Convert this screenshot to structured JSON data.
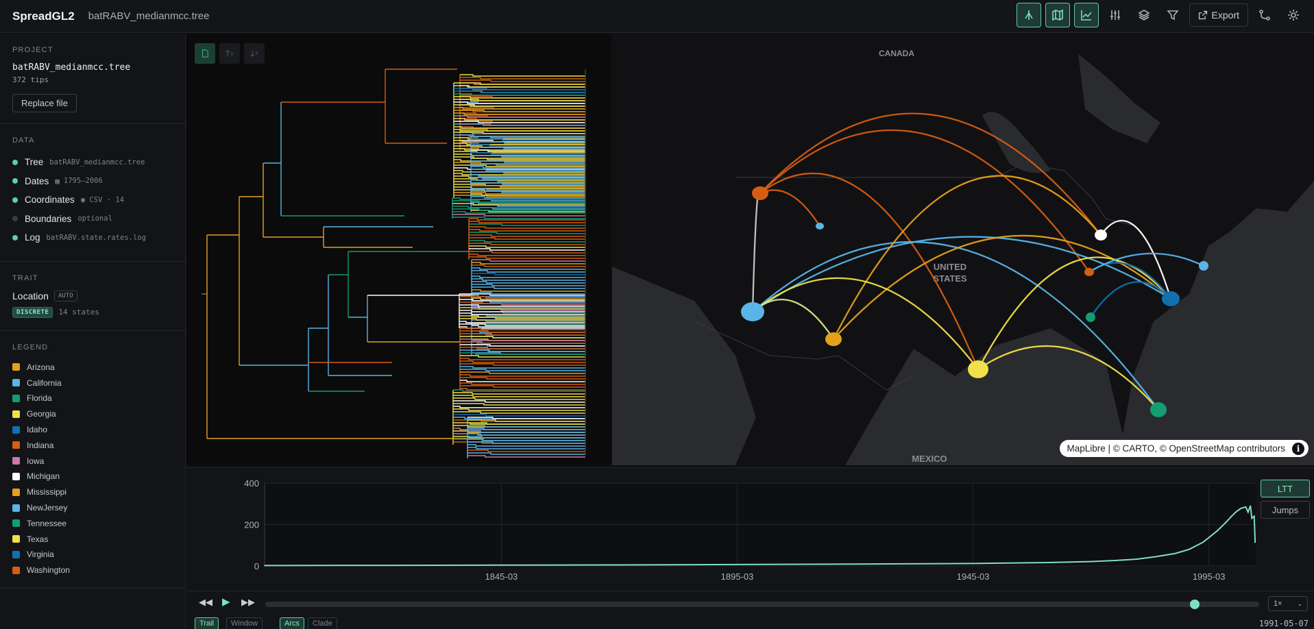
{
  "app": {
    "name": "SpreadGL2",
    "file": "batRABV_medianmcc.tree"
  },
  "toolbar": {
    "export_label": "Export"
  },
  "project": {
    "section": "PROJECT",
    "name": "batRABV_medianmcc.tree",
    "tips": "372 tips",
    "replace_label": "Replace file"
  },
  "data": {
    "section": "DATA",
    "rows": [
      {
        "label": "Tree",
        "meta": "batRABV_medianmcc.tree",
        "status_color": "#5ccfa8",
        "icon": ""
      },
      {
        "label": "Dates",
        "meta": "1795–2006",
        "status_color": "#5ccfa8",
        "icon": "calendar-icon"
      },
      {
        "label": "Coordinates",
        "meta": "CSV · 14",
        "status_color": "#5ccfa8",
        "icon": "map-pin-icon"
      },
      {
        "label": "Boundaries",
        "meta": "optional",
        "status_color": "#3a3d44",
        "icon": ""
      },
      {
        "label": "Log",
        "meta": "batRABV.state.rates.log",
        "status_color": "#5ccfa8",
        "icon": ""
      }
    ]
  },
  "trait": {
    "section": "TRAIT",
    "name": "Location",
    "auto": "AUTO",
    "kind": "DISCRETE",
    "states": "14 states"
  },
  "legend": {
    "section": "LEGEND",
    "items": [
      {
        "name": "Arizona",
        "color": "#e5a11c"
      },
      {
        "name": "California",
        "color": "#5ab4e8"
      },
      {
        "name": "Florida",
        "color": "#129e72"
      },
      {
        "name": "Georgia",
        "color": "#f0e04a"
      },
      {
        "name": "Idaho",
        "color": "#1170b0"
      },
      {
        "name": "Indiana",
        "color": "#d55e12"
      },
      {
        "name": "Iowa",
        "color": "#cc79a7"
      },
      {
        "name": "Michigan",
        "color": "#ffffff"
      },
      {
        "name": "Mississippi",
        "color": "#e5a11c"
      },
      {
        "name": "NewJersey",
        "color": "#5ab4e8"
      },
      {
        "name": "Tennessee",
        "color": "#129e72"
      },
      {
        "name": "Texas",
        "color": "#f0e04a"
      },
      {
        "name": "Virginia",
        "color": "#1170b0"
      },
      {
        "name": "Washington",
        "color": "#d55e12"
      }
    ]
  },
  "map": {
    "labels": {
      "canada": "CANADA",
      "usa_1": "UNITED",
      "usa_2": "STATES",
      "mexico": "MEXICO"
    },
    "attribution": "MapLibre | © CARTO, © OpenStreetMap contributors"
  },
  "chart_data": {
    "type": "line",
    "title": "",
    "ylabel": "",
    "xlabel": "",
    "ylim": [
      0,
      400
    ],
    "y_ticks": [
      0,
      200,
      400
    ],
    "x_range": [
      1795,
      2006
    ],
    "x_ticks": [
      {
        "x": 1845.2,
        "label": "1845-03"
      },
      {
        "x": 1895.2,
        "label": "1895-03"
      },
      {
        "x": 1945.2,
        "label": "1945-03"
      },
      {
        "x": 1995.2,
        "label": "1995-03"
      }
    ],
    "series": [
      {
        "x": [
          1795,
          1820,
          1845,
          1870,
          1895,
          1920,
          1945,
          1960,
          1970,
          1975,
          1980,
          1984,
          1988,
          1991,
          1994,
          1997,
          1999,
          2000,
          2001,
          2002,
          2003,
          2003.5,
          2004,
          2004.3,
          2004.8,
          2005,
          2006
        ],
        "values": [
          2,
          3,
          4,
          5,
          7,
          9,
          12,
          16,
          21,
          26,
          33,
          45,
          60,
          80,
          115,
          170,
          215,
          240,
          262,
          278,
          285,
          260,
          290,
          230,
          240,
          115,
          118
        ]
      }
    ],
    "view": {
      "left": "LTT",
      "right": "Jumps"
    }
  },
  "timeline": {
    "speed": "1×",
    "trail": "Trail",
    "window": "Window",
    "arcs": "Arcs",
    "clade": "Clade",
    "current_date": "1991-05-07",
    "progress": 0.935
  }
}
